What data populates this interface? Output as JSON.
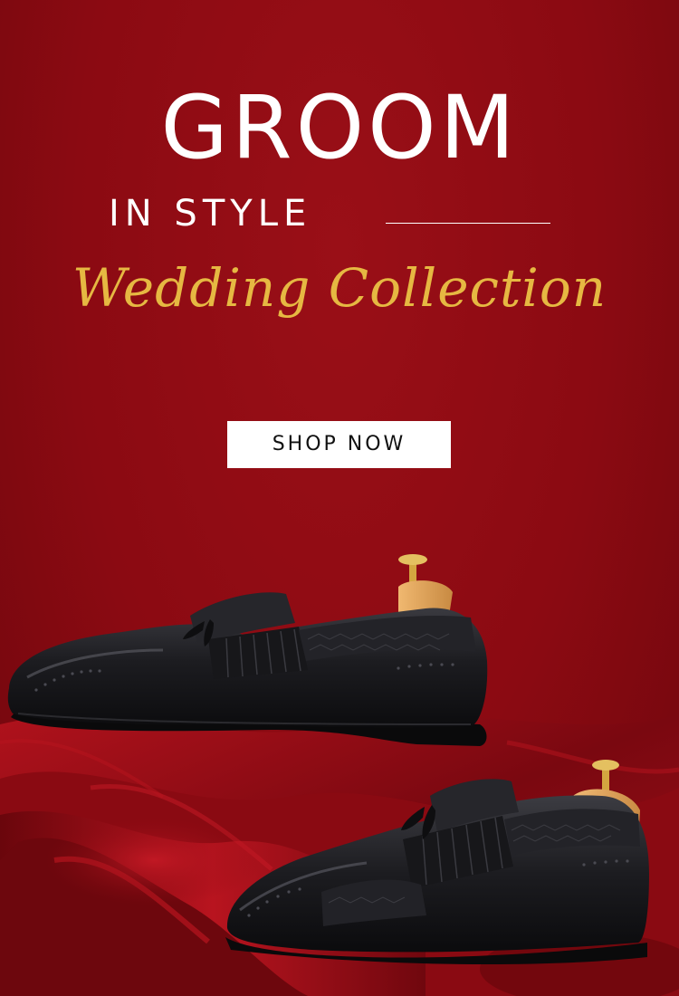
{
  "banner": {
    "headline": "GROOM",
    "subheadline": "IN STYLE",
    "script_title": "Wedding Collection",
    "cta_label": "SHOP NOW"
  },
  "colors": {
    "background": "#8e0b13",
    "headline_text": "#ffffff",
    "script_text": "#e6b842",
    "button_background": "#ffffff",
    "button_text": "#111111",
    "shoe_leather": "#1a1a1e",
    "shoe_tree": "#e2a45a"
  },
  "images": {
    "upper_shoe": "black-tassel-loafer-icon",
    "lower_shoe": "black-tassel-loafer-icon",
    "backdrop": "red-satin-fabric"
  }
}
